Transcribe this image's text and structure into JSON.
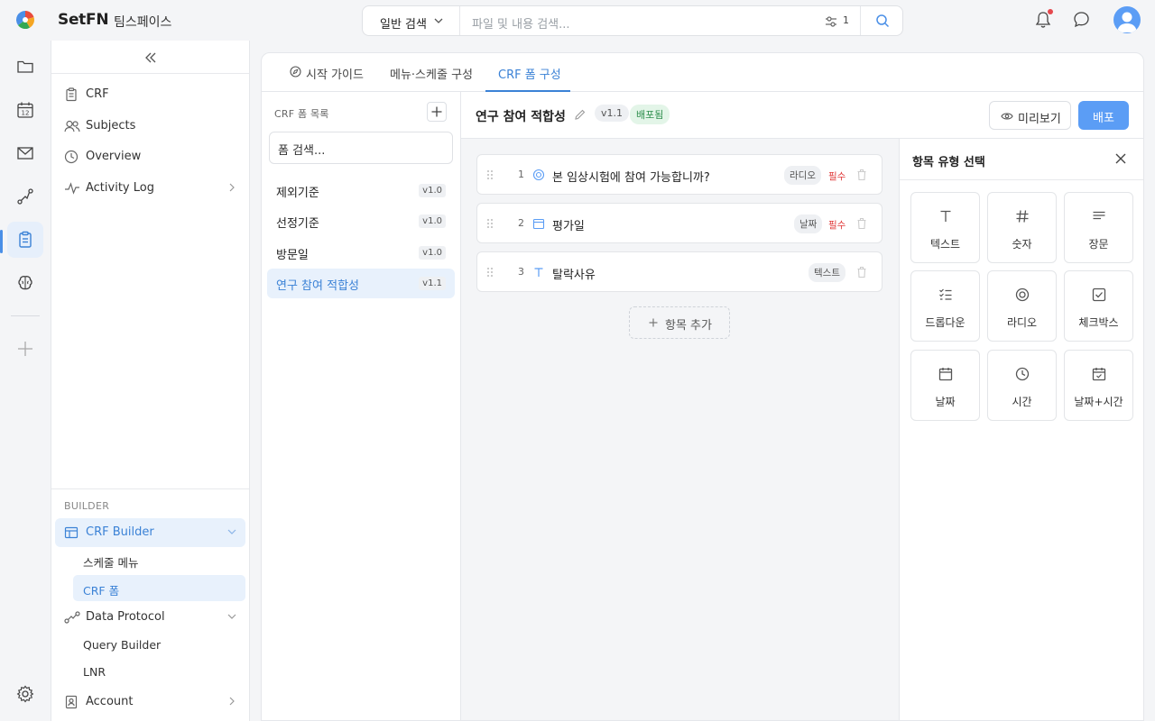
{
  "app": {
    "brand": "SetFN",
    "workspace": "팀스페이스"
  },
  "search": {
    "mode": "일반 검색",
    "placeholder": "파일 및 내용 검색...",
    "filter_count": "1"
  },
  "sidebar": {
    "items": [
      {
        "label": "CRF",
        "icon": "clipboard-icon"
      },
      {
        "label": "Subjects",
        "icon": "users-icon"
      },
      {
        "label": "Overview",
        "icon": "clock-icon"
      },
      {
        "label": "Activity Log",
        "icon": "activity-icon"
      }
    ],
    "section_label": "BUILDER",
    "builder": {
      "crf_builder": "CRF Builder",
      "crf_builder_children": [
        "스케줄 메뉴",
        "CRF 폼"
      ],
      "data_protocol": "Data Protocol",
      "data_protocol_children": [
        "Query Builder",
        "LNR"
      ],
      "account": "Account"
    }
  },
  "tabs": [
    {
      "label": "시작 가이드",
      "icon": "compass-icon"
    },
    {
      "label": "메뉴·스케줄 구성"
    },
    {
      "label": "CRF 폼 구성",
      "active": true
    }
  ],
  "form_list": {
    "title": "CRF 폼 목록",
    "search_value": "폼 검색...",
    "items": [
      {
        "name": "제외기준",
        "version": "v1.0"
      },
      {
        "name": "선정기준",
        "version": "v1.0"
      },
      {
        "name": "방문일",
        "version": "v1.0"
      },
      {
        "name": "연구 참여 적합성",
        "version": "v1.1",
        "active": true
      }
    ]
  },
  "editor": {
    "title": "연구 참여 적합성",
    "version": "v1.1",
    "status": "배포됨",
    "preview_label": "미리보기",
    "deploy_label": "배포",
    "fields": [
      {
        "num": "1",
        "icon": "radio-icon",
        "label": "본 임상시험에 참여 가능합니까?",
        "type": "라디오",
        "required": "필수"
      },
      {
        "num": "2",
        "icon": "calendar-icon",
        "label": "평가일",
        "type": "날짜",
        "required": "필수"
      },
      {
        "num": "3",
        "icon": "text-icon",
        "label": "탈락사유",
        "type": "텍스트",
        "required": ""
      }
    ],
    "add_label": "항목 추가"
  },
  "type_panel": {
    "title": "항목 유형 선택",
    "types": [
      "텍스트",
      "숫자",
      "장문",
      "드롭다운",
      "라디오",
      "체크박스",
      "날짜",
      "시간",
      "날짜+시간"
    ]
  },
  "colors": {
    "accent": "#3b82d6",
    "primary_button": "#5b9df5",
    "required": "#e03a3a",
    "deployed": "#2f8f4e"
  }
}
